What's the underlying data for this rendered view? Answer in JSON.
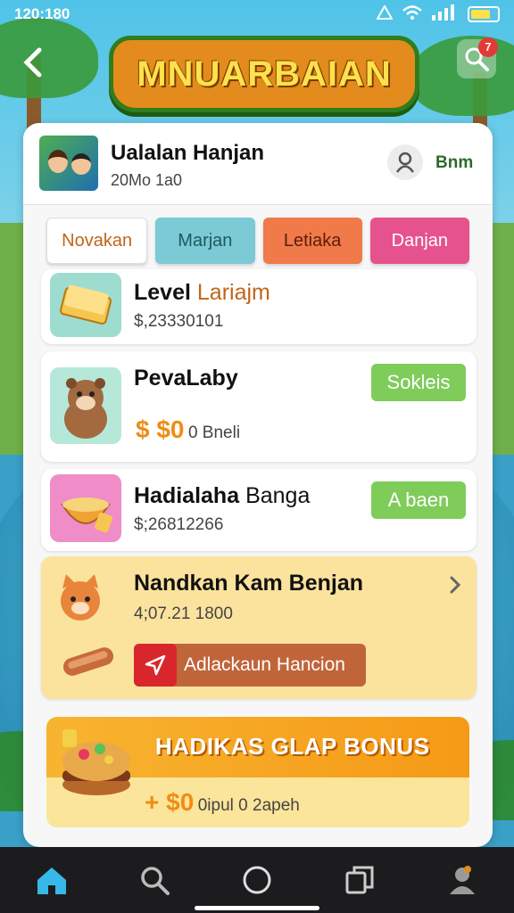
{
  "status_bar": {
    "time": "120:180"
  },
  "header": {
    "title": "MNUARBAIAN",
    "notification_count": "7"
  },
  "profile": {
    "name": "Ualalan Hanjan",
    "sub": "20Mo 1a0",
    "right_label": "Bnm"
  },
  "tabs": [
    {
      "label": "Novakan"
    },
    {
      "label": "Marjan"
    },
    {
      "label": "Letiaka"
    },
    {
      "label": "Danjan"
    }
  ],
  "cards": {
    "level": {
      "title": "Level",
      "title_highlight": "Lariajm",
      "sub": "$,23330101"
    },
    "pevalaby": {
      "title": "PevaLaby",
      "button": "Sokleis",
      "price": "$ $0",
      "price_note": "0 Bneli"
    },
    "hadialaha": {
      "title": "Hadialaha",
      "title_light": "Banga",
      "sub": "$;26812266",
      "button": "A baen"
    },
    "nandkan": {
      "title": "Nandkan Kam Benjan",
      "sub": "4;07.21 1800",
      "action": "Adlackaun Hancion"
    }
  },
  "bonus": {
    "title": "HADIKAS GLAP BONUS",
    "price": "+ $0",
    "price_note": "0ipul 0 2apeh"
  },
  "colors": {
    "accent_orange": "#f08c14",
    "green": "#7fcc5a",
    "banner": "#e38b1c"
  }
}
